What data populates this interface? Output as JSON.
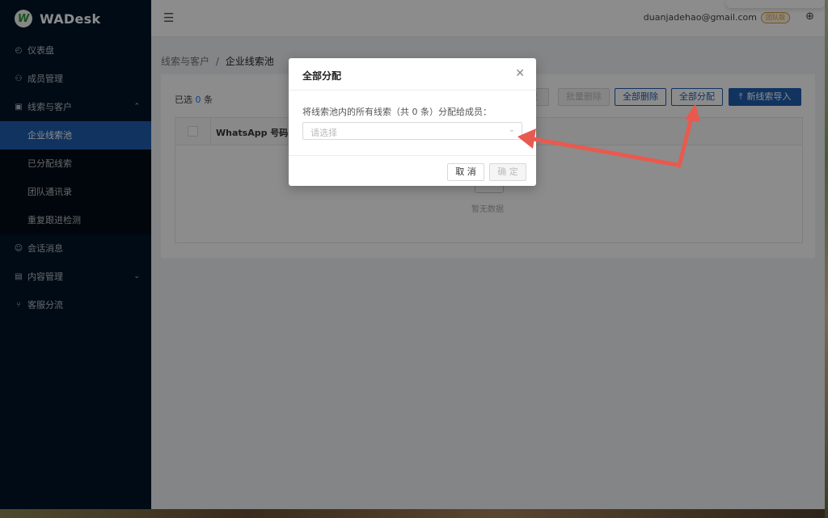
{
  "app": {
    "logo_letter": "W",
    "name": "WADesk"
  },
  "sidebar": {
    "items": [
      {
        "label": "仪表盘",
        "icon": "dashboard-icon"
      },
      {
        "label": "成员管理",
        "icon": "members-icon"
      },
      {
        "label": "线索与客户",
        "icon": "leads-icon",
        "expanded": true
      },
      {
        "label": "会话消息",
        "icon": "chat-icon"
      },
      {
        "label": "内容管理",
        "icon": "content-icon"
      },
      {
        "label": "客服分流",
        "icon": "branch-icon"
      }
    ],
    "sub_items": [
      {
        "label": "企业线索池",
        "active": true
      },
      {
        "label": "已分配线索"
      },
      {
        "label": "团队通讯录"
      },
      {
        "label": "重复跟进检测"
      }
    ]
  },
  "header": {
    "email": "duanjadehao@gmail.com",
    "badge": "团队版"
  },
  "breadcrumb": {
    "parent": "线索与客户",
    "separator": "/",
    "current": "企业线索池"
  },
  "toolbar": {
    "selected_prefix": "已选",
    "selected_count": "0",
    "selected_suffix": "条",
    "partial_hidden_label": "配",
    "batch_delete": "批量删除",
    "delete_all": "全部删除",
    "assign_all": "全部分配",
    "import": "新线索导入"
  },
  "table": {
    "column_whatsapp": "WhatsApp 号码",
    "empty_text": "暂无数据"
  },
  "modal": {
    "title": "全部分配",
    "label": "将线索池内的所有线索（共 0 条）分配给成员：",
    "select_placeholder": "请选择",
    "cancel": "取 消",
    "confirm": "确 定"
  },
  "colors": {
    "sidebar_bg": "#001529",
    "active": "#1f5eb0",
    "annotation": "#e85a4f"
  }
}
